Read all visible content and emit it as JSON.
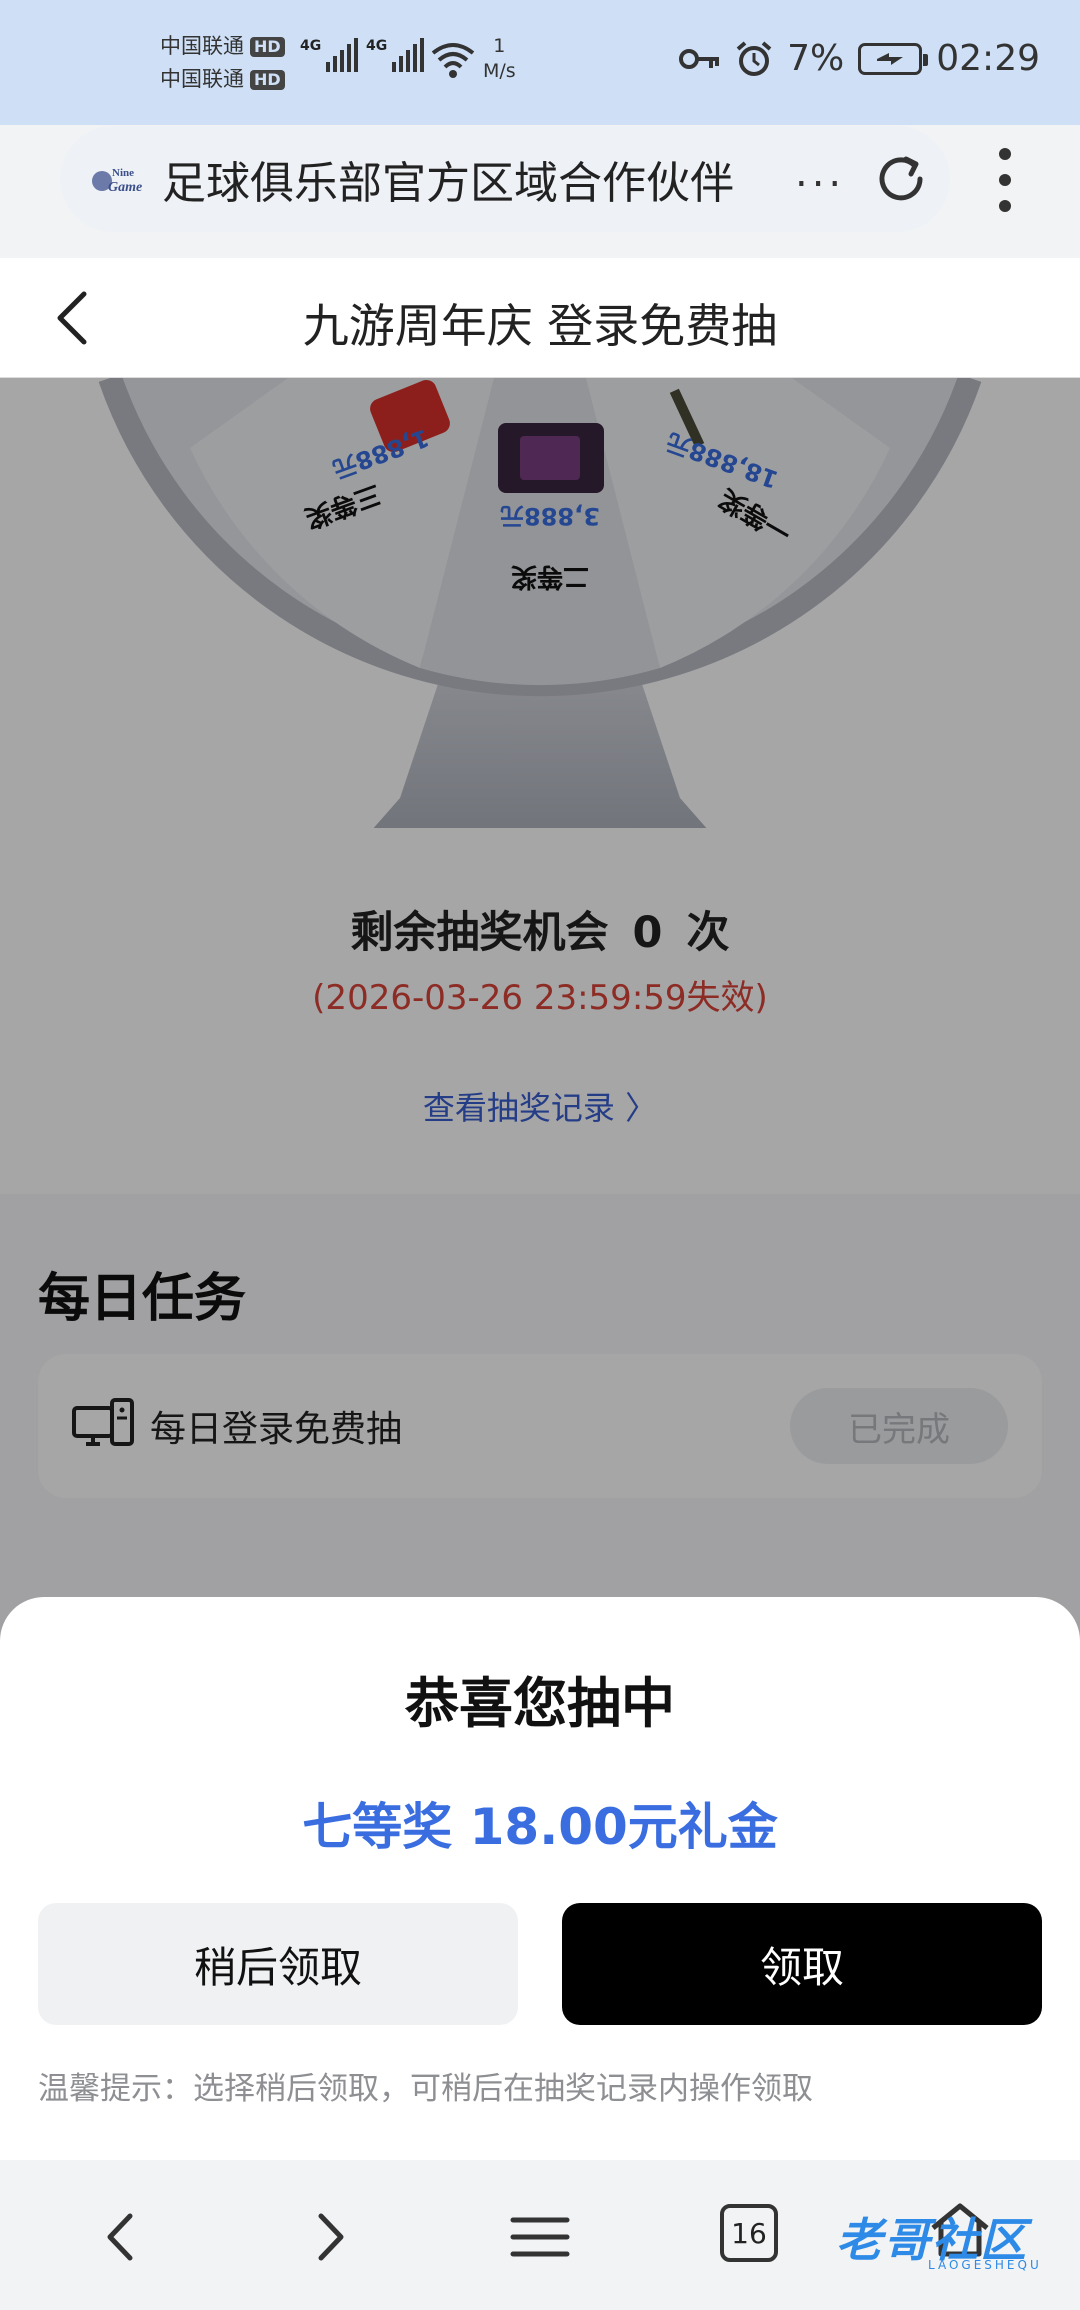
{
  "status_bar": {
    "carrier_1": "中国联通",
    "carrier_2": "中国联通",
    "hd": "HD",
    "network": "4G",
    "speed_value": "1",
    "speed_unit": "M/s",
    "battery": "7%",
    "time": "02:29"
  },
  "url_bar": {
    "site_logo_text": "NineGame",
    "title": "足球俱乐部官方区域合作伙伴",
    "ellipsis": "..."
  },
  "page": {
    "title": "九游周年庆 登录免费抽",
    "wheel": {
      "prizes": [
        {
          "rank": "三等奖",
          "value": "1,888元"
        },
        {
          "rank": "二等奖",
          "value": "3,888元"
        },
        {
          "rank": "一等奖",
          "value": "18,888元"
        }
      ]
    },
    "draws_label": "剩余抽奖机会",
    "draws_count": "0",
    "draws_unit": "次",
    "expiry": "(2026-03-26 23:59:59失效)",
    "record_link": "查看抽奖记录 〉"
  },
  "tasks": {
    "title": "每日任务",
    "items": [
      {
        "label": "每日登录免费抽",
        "status": "已完成"
      }
    ]
  },
  "sheet": {
    "title": "恭喜您抽中",
    "prize": "七等奖 18.00元礼金",
    "later_button": "稍后领取",
    "claim_button": "领取",
    "tip": "温馨提示：选择稍后领取，可稍后在抽奖记录内操作领取"
  },
  "toolbar": {
    "tab_count": "16",
    "watermark": "老哥社区",
    "watermark_sub": "LAOGESHEQU"
  },
  "colors": {
    "status_bg": "#cfe0f6",
    "accent_blue": "#3a6ee0",
    "expiry_red": "#d9423a",
    "claim_button_bg": "#000000"
  }
}
